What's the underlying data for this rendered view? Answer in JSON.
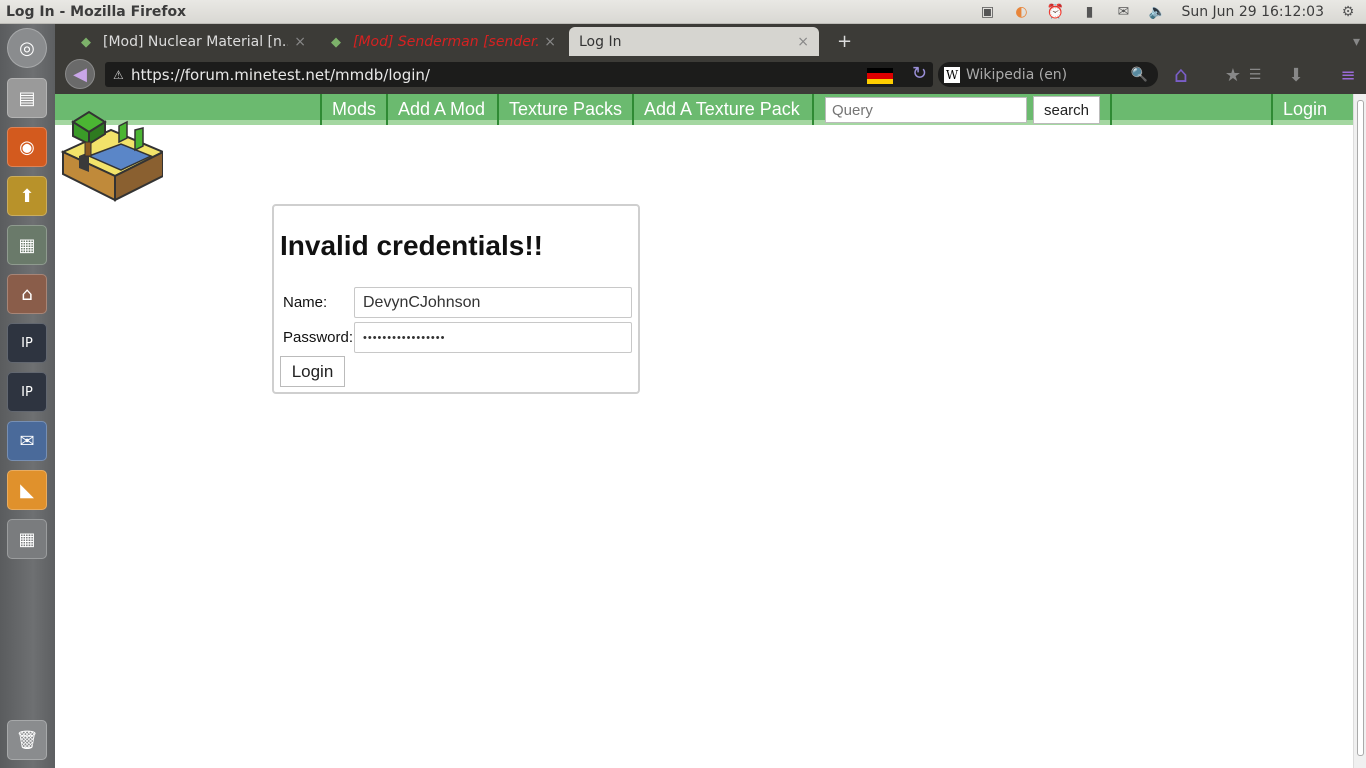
{
  "window": {
    "title": "Log In - Mozilla Firefox"
  },
  "panel": {
    "clock": "Sun Jun 29 16:12:03"
  },
  "tabs": [
    {
      "label": "[Mod] Nuclear Material [n...",
      "active": false
    },
    {
      "label": "[Mod] Senderman [sender...",
      "active": false
    },
    {
      "label": "Log In",
      "active": true
    }
  ],
  "new_tab_label": "+",
  "url": "https://forum.minetest.net/mmdb/login/",
  "search_engine": {
    "name": "Wikipedia (en)",
    "icon_letter": "W"
  },
  "site_nav": {
    "items": [
      "Mods",
      "Add A Mod",
      "Texture Packs",
      "Add A Texture Pack"
    ],
    "query_placeholder": "Query",
    "search_label": "search",
    "login_label": "Login"
  },
  "login_form": {
    "heading": "Invalid credentials!!",
    "name_label": "Name:",
    "name_value": "DevynCJohnson",
    "password_label": "Password:",
    "password_value": "•••••••••••••••••",
    "submit_label": "Login"
  },
  "colors": {
    "nav_green": "#6bba6f",
    "nav_border": "#2f8a34",
    "tab_red": "#d62121"
  }
}
